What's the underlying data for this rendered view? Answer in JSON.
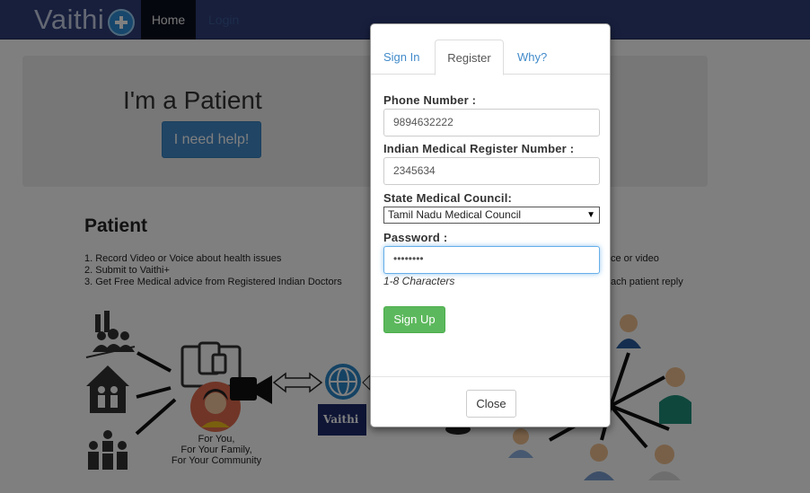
{
  "navbar": {
    "brand": "Vaithi",
    "home_label": "Home",
    "login_label": "Login"
  },
  "hero": {
    "title": "I'm a Patient",
    "button_label": "I need help!"
  },
  "patient_section": {
    "title": "Patient",
    "steps": [
      "1. Record Video or Voice about health issues",
      "2. Submit to Vaithi+",
      "3. Get Free Medical advice from Registered Indian Doctors"
    ],
    "captions": [
      "For You,",
      "For Your Family,",
      "For Your Community"
    ],
    "logo_text": "Vaithi"
  },
  "doctor_section": {
    "steps_partial": [
      "ce or video",
      "ach patient reply"
    ]
  },
  "modal": {
    "tabs": [
      "Sign In",
      "Register",
      "Why?"
    ],
    "active_tab": "Register",
    "fields": {
      "phone": {
        "label": "Phone Number :",
        "value": "9894632222"
      },
      "register_number": {
        "label": "Indian Medical Register Number :",
        "value": "2345634"
      },
      "council": {
        "label": "State Medical Council:",
        "value": "Tamil Nadu Medical Council"
      },
      "password": {
        "label": "Password :",
        "value": "••••••••",
        "hint": "1-8 Characters"
      }
    },
    "signup_label": "Sign Up",
    "close_label": "Close"
  },
  "colors": {
    "navbar": "#2e3f7a",
    "primary": "#428bca",
    "success": "#5cb85c",
    "backdrop": "rgba(0,0,0,0.5)"
  }
}
